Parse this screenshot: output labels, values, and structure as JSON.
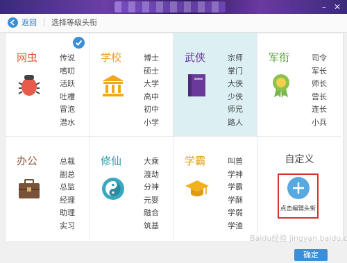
{
  "toolbar": {
    "back_label": "返回",
    "breadcrumb": "选择等级头衔"
  },
  "categories": [
    {
      "name": "网虫",
      "color": "#e05a3a",
      "icon": "bug-icon",
      "selected": false,
      "checked": true,
      "titles": [
        "传说",
        "嗜叨",
        "活跃",
        "吐槽",
        "冒泡",
        "潜水"
      ]
    },
    {
      "name": "学校",
      "color": "#f0a020",
      "icon": "school-icon",
      "selected": false,
      "checked": false,
      "titles": [
        "博士",
        "硕士",
        "大学",
        "高中",
        "初中",
        "小学"
      ]
    },
    {
      "name": "武侠",
      "color": "#6a3a9a",
      "icon": "book-icon",
      "selected": true,
      "checked": false,
      "titles": [
        "宗师",
        "掌门",
        "大侠",
        "少侠",
        "师兄",
        "路人"
      ]
    },
    {
      "name": "军衔",
      "color": "#5aa23a",
      "icon": "medal-icon",
      "selected": false,
      "checked": false,
      "titles": [
        "司令",
        "军长",
        "师长",
        "营长",
        "连长",
        "小兵"
      ]
    },
    {
      "name": "办公",
      "color": "#8a5a3a",
      "icon": "briefcase-icon",
      "selected": false,
      "checked": false,
      "titles": [
        "总裁",
        "副总",
        "总监",
        "经理",
        "助理",
        "实习"
      ]
    },
    {
      "name": "修仙",
      "color": "#2a9ab0",
      "icon": "taiji-icon",
      "selected": false,
      "checked": false,
      "titles": [
        "大乘",
        "渡劫",
        "分神",
        "元婴",
        "融合",
        "筑基"
      ]
    },
    {
      "name": "学霸",
      "color": "#e0a010",
      "icon": "graduation-cap-icon",
      "selected": false,
      "checked": false,
      "titles": [
        "叫兽",
        "学神",
        "学霸",
        "学酥",
        "学弱",
        "学渣"
      ]
    }
  ],
  "custom": {
    "title": "自定义",
    "add_label": "点击编辑头衔"
  },
  "footer": {
    "ok_label": "确定",
    "watermark": "Baidu经验 jingyan.baidu.com"
  }
}
